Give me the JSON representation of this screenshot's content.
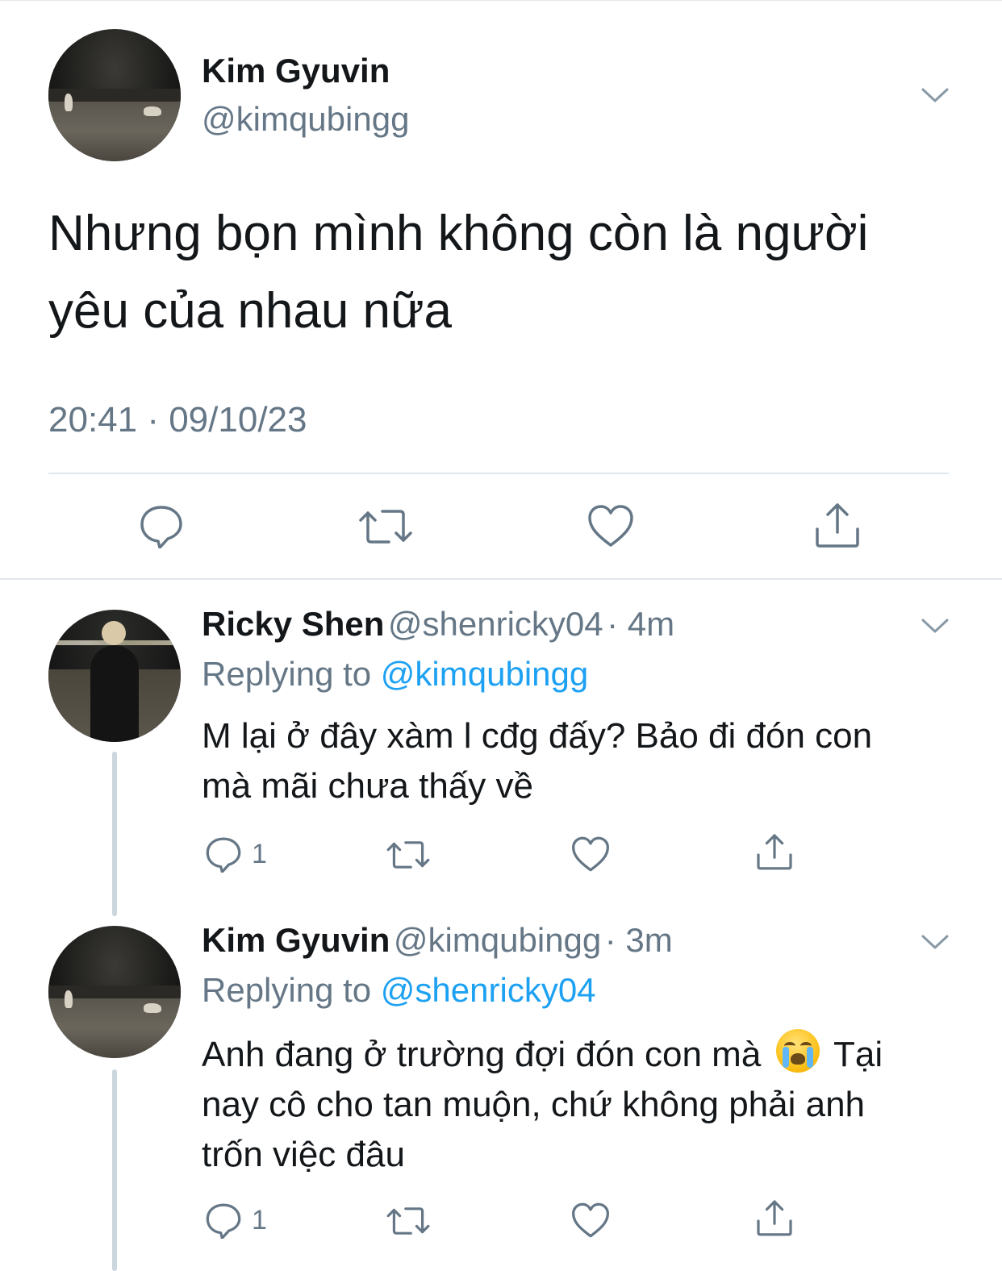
{
  "main_tweet": {
    "author_name": "Kim Gyuvin",
    "author_handle": "@kimqubingg",
    "text_line1": "Nhưng bọn mình không còn là người",
    "text_line2": "yêu của nhau nữa",
    "timestamp": "20:41 · 09/10/23"
  },
  "replies": [
    {
      "author_name": "Ricky Shen",
      "author_handle": "@shenricky04",
      "time": "· 4m",
      "replying_label": "Replying to",
      "replying_to": "@kimqubingg",
      "text_line1": "M lại ở đây xàm l cđg đấy? Bảo đi đón con",
      "text_line2": "mà mãi chưa thấy về",
      "reply_count": "1"
    },
    {
      "author_name": "Kim Gyuvin",
      "author_handle": "@kimqubingg",
      "time": "· 3m",
      "replying_label": "Replying to",
      "replying_to": "@shenricky04",
      "text_line1a": "Anh đang ở trường đợi đón con mà",
      "emoji": "loudly-crying-face-emoji",
      "text_line1b": "Tại",
      "text_line2": "nay cô cho tan muộn, chứ không phải anh",
      "text_line3": "trốn việc đâu",
      "reply_count": "1"
    }
  ],
  "colors": {
    "text": "#14171a",
    "secondary": "#657786",
    "link": "#1da1f2",
    "divider": "#e1e8ed",
    "thread_line": "#ccd6dd"
  }
}
